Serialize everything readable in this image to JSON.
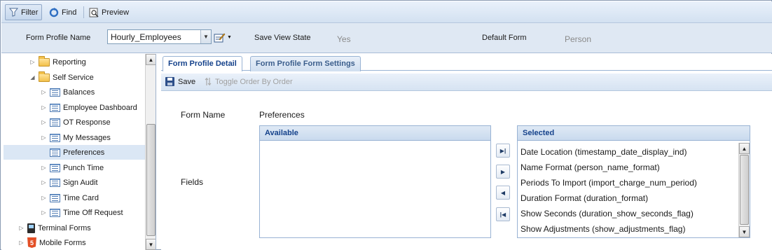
{
  "toolbar": {
    "filter_label": "Filter",
    "find_label": "Find",
    "preview_label": "Preview"
  },
  "profile_bar": {
    "form_profile_label": "Form Profile Name",
    "form_profile_value": "Hourly_Employees",
    "save_view_state_label": "Save View State",
    "save_view_state_value": "Yes",
    "default_form_label": "Default Form",
    "default_form_value": "Person"
  },
  "tree": {
    "items": [
      {
        "label": "Reporting",
        "icon": "folder-icon",
        "expanded": false
      },
      {
        "label": "Self Service",
        "icon": "folder-icon",
        "expanded": true
      },
      {
        "label": "Balances",
        "icon": "form-icon"
      },
      {
        "label": "Employee Dashboard",
        "icon": "form-icon"
      },
      {
        "label": "OT Response",
        "icon": "form-icon"
      },
      {
        "label": "My Messages",
        "icon": "form-icon"
      },
      {
        "label": "Preferences",
        "icon": "form-icon",
        "selected": true
      },
      {
        "label": "Punch Time",
        "icon": "form-icon"
      },
      {
        "label": "Sign Audit",
        "icon": "form-icon"
      },
      {
        "label": "Time Card",
        "icon": "form-icon"
      },
      {
        "label": "Time Off Request",
        "icon": "form-icon"
      },
      {
        "label": "Terminal Forms",
        "icon": "terminal-icon"
      },
      {
        "label": "Mobile Forms",
        "icon": "html5-icon"
      }
    ]
  },
  "tabs": [
    {
      "label": "Form Profile Detail",
      "active": true
    },
    {
      "label": "Form Profile Form Settings",
      "active": false
    }
  ],
  "detail_toolbar": {
    "save_label": "Save",
    "toggle_order_label": "Toggle Order By Order"
  },
  "form": {
    "form_name_label": "Form Name",
    "form_name_value": "Preferences",
    "fields_label": "Fields",
    "available_header": "Available",
    "available_items": [],
    "selected_header": "Selected",
    "selected_items": [
      "Date Location (timestamp_date_display_ind)",
      "Name Format (person_name_format)",
      "Periods To Import (import_charge_num_period)",
      "Duration Format (duration_format)",
      "Show Seconds (duration_show_seconds_flag)",
      "Show Adjustments (show_adjustments_flag)"
    ]
  },
  "colors": {
    "accent": "#15428b",
    "toolbar_bg": "#d3e1f1",
    "selected_row": "#dbe7f5"
  }
}
